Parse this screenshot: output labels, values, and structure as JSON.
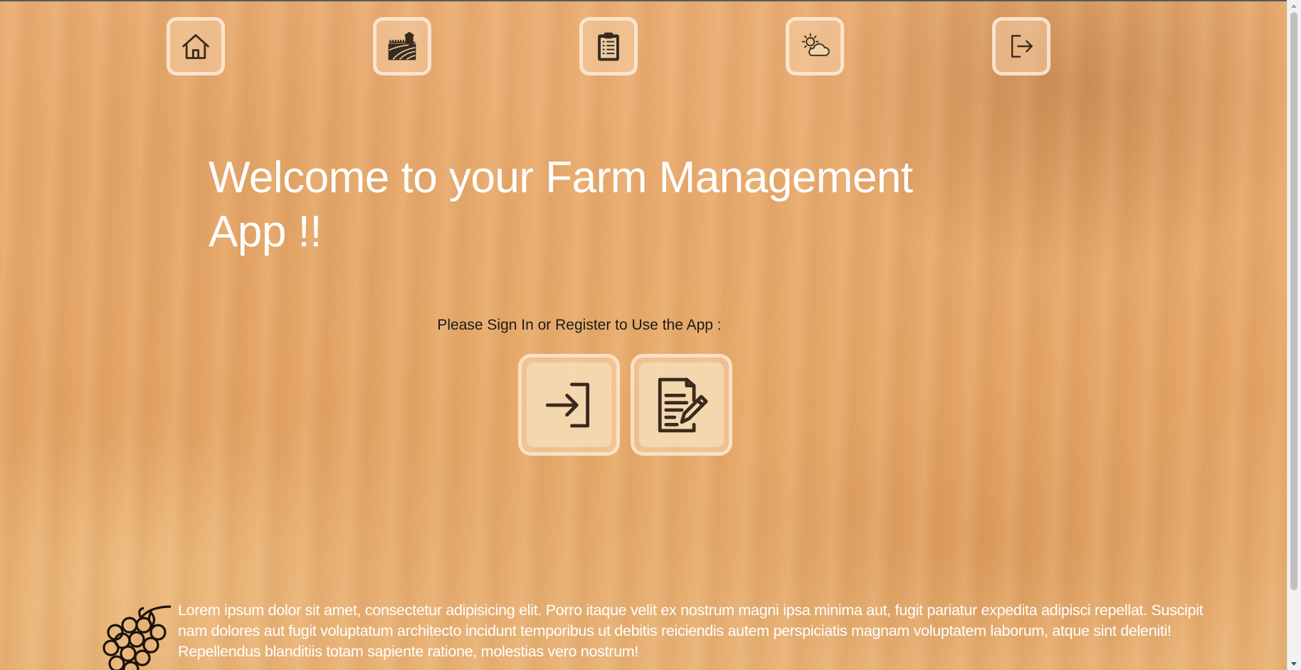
{
  "nav": {
    "items": [
      {
        "name": "home",
        "icon": "home-icon"
      },
      {
        "name": "farm",
        "icon": "farm-field-icon"
      },
      {
        "name": "tasks",
        "icon": "clipboard-list-icon"
      },
      {
        "name": "weather",
        "icon": "sun-cloud-icon"
      },
      {
        "name": "logout",
        "icon": "logout-icon"
      }
    ]
  },
  "hero": {
    "headline": "Welcome to your Farm Management App !!",
    "prompt": "Please Sign In or Register to Use the App :"
  },
  "actions": {
    "sign_in": {
      "icon": "sign-in-icon"
    },
    "register": {
      "icon": "register-document-icon"
    }
  },
  "footer": {
    "icon": "grapes-icon",
    "text": "Lorem ipsum dolor sit amet, consectetur adipisicing elit. Porro itaque velit ex nostrum magni ipsa minima aut, fugit pariatur expedita adipisci repellat. Suscipit nam dolores aut fugit voluptatum architecto incidunt temporibus ut debitis reiciendis autem perspiciatis magnam voluptatem laborum, atque sint deleniti! Repellendus blanditiis totam sapiente ratione, molestias vero nostrum!"
  },
  "colors": {
    "background": "#e7a96c",
    "icon_stroke": "#3a2a1e",
    "headline": "#ffffff"
  }
}
